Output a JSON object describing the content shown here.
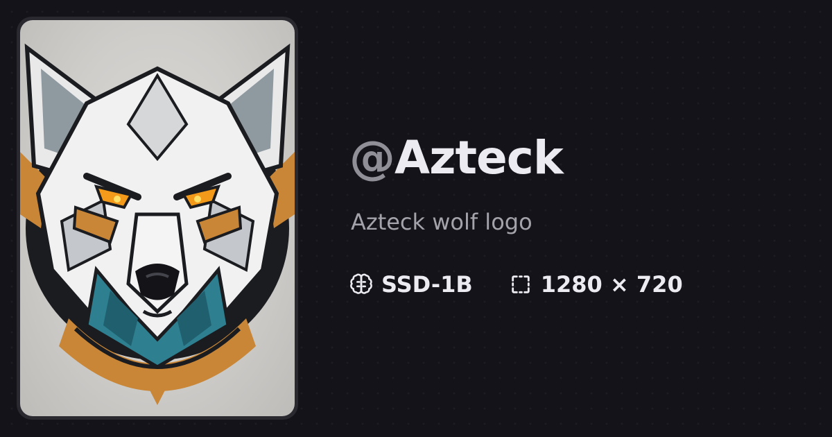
{
  "profile": {
    "handle_prefix": "@",
    "handle": "Azteck",
    "prompt": "Azteck wolf logo"
  },
  "meta": {
    "model_label": "SSD-1B",
    "model_icon": "brain-icon",
    "dimensions_label": "1280 × 720",
    "dimensions_icon": "dashed-square-icon"
  },
  "image": {
    "description_icon": "wolf-logo-image"
  },
  "colors": {
    "background": "#141319",
    "text_primary": "#ecebf2",
    "text_muted": "#a4a3ab",
    "handle_prefix": "#908f98"
  }
}
